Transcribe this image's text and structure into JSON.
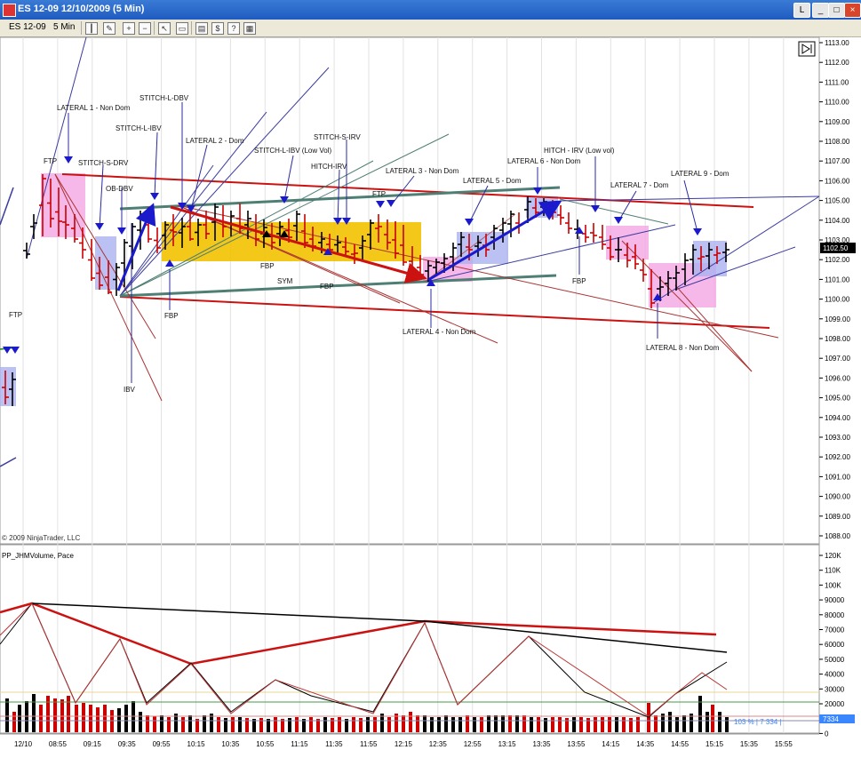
{
  "window": {
    "title": "ES 12-09  12/10/2009 (5 Min)",
    "min_label": "_",
    "max_label": "□",
    "close_label": "×",
    "L_label": "L"
  },
  "toolbar": {
    "instrument": "ES 12-09",
    "interval": "5 Min",
    "icons": [
      "bar-type-icon",
      "pencil-icon",
      "zoom-in-icon",
      "zoom-out-icon",
      "pointer-icon",
      "properties-icon",
      "data-box-icon",
      "chart-trader-icon",
      "help-icon"
    ]
  },
  "price_axis": {
    "labels": [
      "1113.00",
      "1112.00",
      "1111.00",
      "1110.00",
      "1109.00",
      "1108.00",
      "1107.00",
      "1106.00",
      "1105.00",
      "1104.00",
      "1103.00",
      "1102.00",
      "1101.00",
      "1100.00",
      "1099.00",
      "1098.00",
      "1097.00",
      "1096.00",
      "1095.00",
      "1094.00",
      "1093.00",
      "1092.00",
      "1091.00",
      "1090.00",
      "1089.00",
      "1088.00"
    ],
    "current_price": "1102.50"
  },
  "volume_axis": {
    "labels": [
      "120K",
      "110K",
      "100K",
      "90000",
      "80000",
      "70000",
      "60000",
      "50000",
      "40000",
      "30000",
      "20000",
      "10000",
      "0"
    ],
    "current_volume": "7334"
  },
  "time_axis": {
    "labels": [
      "12/10",
      "08:55",
      "09:15",
      "09:35",
      "09:55",
      "10:15",
      "10:35",
      "10:55",
      "11:15",
      "11:35",
      "11:55",
      "12:15",
      "12:35",
      "12:55",
      "13:15",
      "13:35",
      "13:55",
      "14:15",
      "14:35",
      "14:55",
      "15:15",
      "15:35",
      "15:55"
    ]
  },
  "copyright": "© 2009 NinjaTrader, LLC",
  "indicator_label": "PP_JHMVolume, Pace",
  "pace_readout": "103 % | 7 334 |",
  "annotations": {
    "lateral1": "LATERAL 1 - Non Dom",
    "stitch_l_dbv": "STITCH-L-DBV",
    "stitch_l_ibv": "STITCH-L-IBV",
    "lateral2": "LATERAL 2 - Dom",
    "stitch_l_ibv_low": "STITCH-L-IBV (Low Vol)",
    "stitch_s_irv": "STITCH-S-IRV",
    "hitch_irv": "HITCH-IRV",
    "ftp_left": "FTP",
    "stitch_s_drv": "STITCH-S-DRV",
    "ob_dbv": "OB-DBV",
    "ftp_mid": "FTP",
    "lateral3": "LATERAL 3 - Non Dom",
    "lateral5": "LATERAL 5 - Dom",
    "lateral6": "LATERAL 6 - Non Dom",
    "hitch_irv_low": "HITCH - IRV (Low vol)",
    "lateral7": "LATERAL 7 - Dom",
    "lateral9": "LATERAL 9 - Dom",
    "fbp1": "FBP",
    "sym": "SYM",
    "fbp2": "FBP",
    "fbp3": "FBP",
    "fbp4": "FBP",
    "ibv": "IBV",
    "lateral4": "LATERAL 4 - Non Dom",
    "lateral8": "LATERAL 8 - Non Dom",
    "ftp_far_left": "FTP"
  },
  "colors": {
    "title_bar": "#1f5bc0",
    "toolbar": "#ece9d8",
    "up_bar": "#000000",
    "down_bar": "#cc0000",
    "lateral_pink": "#f4a6e4",
    "lateral_blue": "#aab2f0",
    "highlight_yellow": "#f2c200",
    "arrow_blue": "#1a1acc",
    "trend_red": "#cc1111",
    "channel_gray": "#4f7f74",
    "current_price_bg": "#000000"
  }
}
